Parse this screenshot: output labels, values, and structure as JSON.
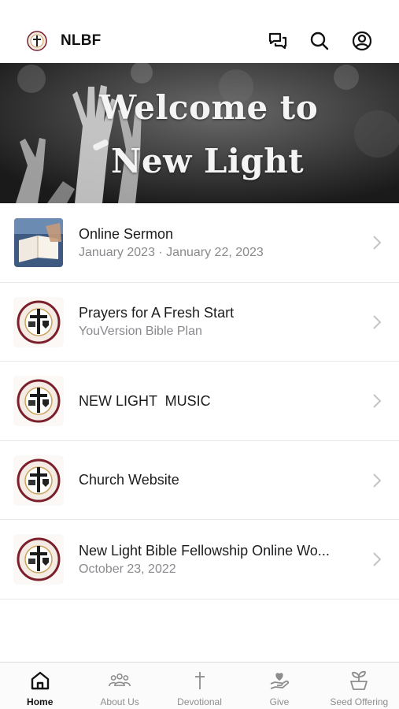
{
  "status_bar": {
    "text": ""
  },
  "header": {
    "title": "NLBF",
    "icons": [
      "messages-icon",
      "search-icon",
      "account-icon"
    ]
  },
  "hero": {
    "line1": "Welcome to",
    "line2": "New Light"
  },
  "list": [
    {
      "title": "Online Sermon",
      "subtitle": "January 2023 · January 22, 2023",
      "thumb": "bible-photo"
    },
    {
      "title": "Prayers for A Fresh Start",
      "subtitle": "YouVersion Bible Plan",
      "thumb": "church-logo"
    },
    {
      "title": "NEW LIGHT  MUSIC",
      "subtitle": "",
      "thumb": "church-logo"
    },
    {
      "title": "Church Website",
      "subtitle": "",
      "thumb": "church-logo"
    },
    {
      "title": "New Light Bible Fellowship Online Wo...",
      "subtitle": "October 23, 2022",
      "thumb": "church-logo"
    }
  ],
  "tabs": [
    {
      "label": "Home",
      "icon": "home-icon",
      "active": true
    },
    {
      "label": "About Us",
      "icon": "people-icon",
      "active": false
    },
    {
      "label": "Devotional",
      "icon": "cross-icon",
      "active": false
    },
    {
      "label": "Give",
      "icon": "give-icon",
      "active": false
    },
    {
      "label": "Seed Offering",
      "icon": "sprout-icon",
      "active": false
    }
  ],
  "colors": {
    "text_primary": "#1c1c1e",
    "text_secondary": "#8a8a8e",
    "tab_inactive": "#8d8d8d",
    "logo_maroon": "#7a1f2b"
  }
}
